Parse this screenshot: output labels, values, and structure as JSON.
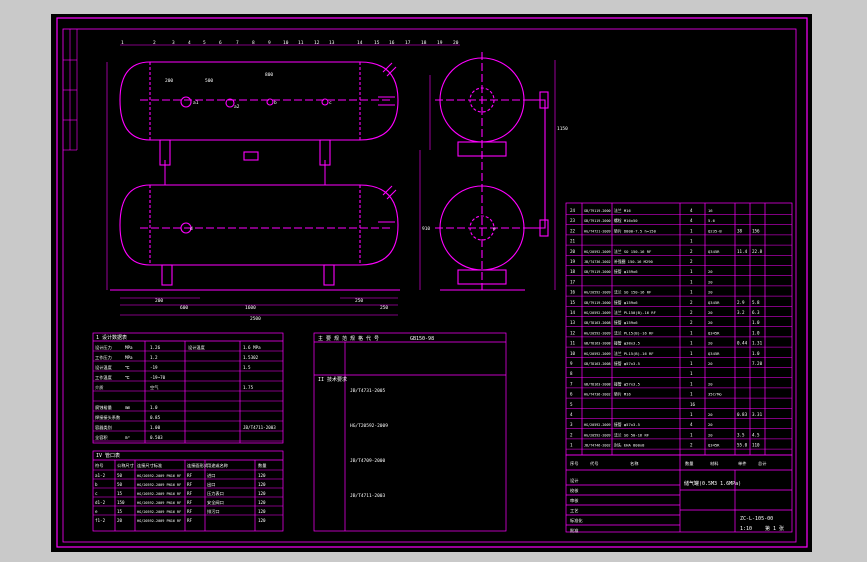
{
  "colors": {
    "background": "#c9c9c9",
    "sheet": "#000000",
    "drawing_line": "#ff00ff",
    "text": "#ffffff",
    "accent_yellow": "#ffff00",
    "accent_cyan": "#00ffff"
  },
  "drawing": {
    "balloon_numbers_top": [
      "1",
      "2",
      "3",
      "4",
      "5",
      "6",
      "7",
      "8",
      "9",
      "10",
      "11",
      "12",
      "13",
      "14",
      "15",
      "16",
      "17",
      "18",
      "19",
      "20"
    ],
    "dimensions": {
      "overall_length": "2500",
      "left_bottom_1": "200",
      "left_bottom_2": "600",
      "left_bottom_3": "1600",
      "right_bottom_1": "250",
      "right_bottom_2": "250",
      "side_dim_1": "200",
      "side_dim_2": "500",
      "side_dim_3": "800",
      "side_right_1": "1150",
      "side_right_2": "910"
    },
    "nozzle_labels": [
      "a1",
      "a2",
      "b",
      "c",
      "d",
      "e"
    ]
  },
  "parts_list": {
    "rows": [
      {
        "no": "24",
        "std": "GB/T9119-2000",
        "name": "法兰 M16",
        "qty": "4",
        "mat": "16",
        "w": "",
        "w2": ""
      },
      {
        "no": "23",
        "std": "GB/T9119-2000",
        "name": "螺栓 M16x50",
        "qty": "4",
        "mat": "5.6",
        "w": "",
        "w2": ""
      },
      {
        "no": "22",
        "std": "HG/T4721-2009",
        "name": "垫片 D800-7.5 h=150",
        "qty": "1",
        "mat": "Q235-B",
        "w": "38",
        "w2": "156"
      },
      {
        "no": "21",
        "std": "",
        "name": "",
        "qty": "1",
        "mat": "",
        "w": "",
        "w2": ""
      },
      {
        "no": "20",
        "std": "HG/20592-2009",
        "name": "法兰 SO 150-16 RF",
        "qty": "2",
        "mat": "Q345R",
        "w": "11.4",
        "w2": "22.8"
      },
      {
        "no": "19",
        "std": "JB/T4736-2002",
        "name": "补强圈 150-16 M290",
        "qty": "2",
        "mat": "",
        "w": "",
        "w2": ""
      },
      {
        "no": "18",
        "std": "GB/T9119-2000",
        "name": "接管 φ159x6",
        "qty": "1",
        "mat": "20",
        "w": "",
        "w2": ""
      },
      {
        "no": "17",
        "std": "",
        "name": "",
        "qty": "1",
        "mat": "20",
        "w": "",
        "w2": ""
      },
      {
        "no": "16",
        "std": "HG/20592-2009",
        "name": "法兰 SO 150-16 RF",
        "qty": "1",
        "mat": "20",
        "w": "",
        "w2": ""
      },
      {
        "no": "15",
        "std": "GB/T9119-2000",
        "name": "接管 φ159x6",
        "qty": "2",
        "mat": "Q345R",
        "w": "2.9",
        "w2": "5.8"
      },
      {
        "no": "14",
        "std": "HG/20592-2009",
        "name": "法兰 PL150(B)-16 RF",
        "qty": "2",
        "mat": "20",
        "w": "3.2",
        "w2": "6.3"
      },
      {
        "no": "13",
        "std": "GB/T8163-2008",
        "name": "接管 φ159x6",
        "qty": "2",
        "mat": "20",
        "w": "",
        "w2": "1.0"
      },
      {
        "no": "12",
        "std": "HG/20592-2009",
        "name": "法兰 PL15(B)-16 RF",
        "qty": "1",
        "mat": "Q345R",
        "w": "",
        "w2": "1.0"
      },
      {
        "no": "11",
        "std": "GB/T8163-2008",
        "name": "接管 φ38x3.5",
        "qty": "1",
        "mat": "20",
        "w": "0.44",
        "w2": "1.31"
      },
      {
        "no": "10",
        "std": "HG/20592-2009",
        "name": "法兰 PL15(B)-16 RF",
        "qty": "1",
        "mat": "Q345R",
        "w": "",
        "w2": "1.0"
      },
      {
        "no": "9",
        "std": "GB/T8163-2008",
        "name": "接管 φ57x3.5",
        "qty": "1",
        "mat": "20",
        "w": "",
        "w2": "7.20"
      },
      {
        "no": "8",
        "std": "",
        "name": "",
        "qty": "1",
        "mat": "",
        "w": "",
        "w2": ""
      },
      {
        "no": "7",
        "std": "GB/T8163-2008",
        "name": "接管 φ57x3.5",
        "qty": "1",
        "mat": "20",
        "w": "",
        "w2": ""
      },
      {
        "no": "6",
        "std": "HG/T4736-2002",
        "name": "垫片 M16",
        "qty": "1",
        "mat": "35CrMo",
        "w": "",
        "w2": ""
      },
      {
        "no": "5",
        "std": "",
        "name": "",
        "qty": "16",
        "mat": "",
        "w": "",
        "w2": ""
      },
      {
        "no": "4",
        "std": "",
        "name": "",
        "qty": "1",
        "mat": "20",
        "w": "0.83",
        "w2": "3.31"
      },
      {
        "no": "3",
        "std": "HG/20592-2009",
        "name": "接管 φ57x3.5",
        "qty": "4",
        "mat": "20",
        "w": "",
        "w2": ""
      },
      {
        "no": "2",
        "std": "HG/20592-2009",
        "name": "法兰 SO 50-16 RF",
        "qty": "1",
        "mat": "20",
        "w": "3.5",
        "w2": "4.5"
      },
      {
        "no": "1",
        "std": "JB/T4746-2002",
        "name": "封头 EHA 800x8",
        "qty": "2",
        "mat": "Q345R",
        "w": "55.0",
        "w2": "110"
      }
    ],
    "footer": {
      "b": "序号",
      "c": "代号",
      "d": "名称",
      "e": "数量",
      "f": "材料",
      "g": "单件",
      "h": "总计"
    }
  },
  "design_data_table": {
    "title": "1 设计数据表",
    "rows": [
      {
        "label": "设计压力",
        "val": "MPa",
        "a": "1.26",
        "b": "",
        "c": "设计温度",
        "d": "1.6 MPa"
      },
      {
        "label": "工作压力",
        "val": "MPa",
        "a": "1.2",
        "b": "",
        "c": "",
        "d": "1.5302"
      },
      {
        "label": "设计温度",
        "val": "℃",
        "a": "-19",
        "b": "",
        "c": "",
        "d": "1.5"
      },
      {
        "label": "工作温度",
        "val": "℃",
        "a": "-19~70",
        "b": "",
        "c": "",
        "d": ""
      },
      {
        "label": "介质",
        "val": "",
        "a": "空气",
        "b": "",
        "c": "",
        "d": "1.75"
      },
      {
        "label": "",
        "val": "",
        "a": "",
        "b": "",
        "c": "",
        "d": ""
      },
      {
        "label": "腐蚀裕量",
        "val": "mm",
        "a": "1.0",
        "b": "",
        "c": "",
        "d": ""
      },
      {
        "label": "焊接接头系数",
        "val": "",
        "a": "0.85",
        "b": "",
        "c": "",
        "d": ""
      },
      {
        "label": "容器类别",
        "val": "",
        "a": "1.00",
        "b": "",
        "c": "",
        "d": "JB/T4711-2003"
      },
      {
        "label": "全容积",
        "val": "m³",
        "a": "0.503",
        "b": "",
        "c": "",
        "d": ""
      }
    ]
  },
  "nozzle_table": {
    "title": "IV 管口表",
    "headers": [
      "符号",
      "公称尺寸",
      "连接尺寸标准",
      "连接面形式",
      "用途或名称",
      "",
      "数量"
    ],
    "rows": [
      {
        "sym": "a1-2",
        "dn": "50",
        "std": "HG/20592-2009 PN16 RF",
        "face": "RF",
        "use": "进口",
        "qty": "120"
      },
      {
        "sym": "b",
        "dn": "50",
        "std": "HG/20592-2009 PN16 RF",
        "face": "RF",
        "use": "出口",
        "qty": "120"
      },
      {
        "sym": "c",
        "dn": "15",
        "std": "HG/20592-2009 PN16 RF",
        "face": "RF",
        "use": "压力表口",
        "qty": "120"
      },
      {
        "sym": "d1-2",
        "dn": "150",
        "std": "HG/20592-2009 PN16 RF",
        "face": "RF",
        "use": "安全阀口",
        "qty": "120"
      },
      {
        "sym": "e",
        "dn": "15",
        "std": "HG/20592-2009 PN16 RF",
        "face": "RF",
        "use": "排污口",
        "qty": "120"
      },
      {
        "sym": "f1-2",
        "dn": "20",
        "std": "HG/20592-2009 PN16 RF",
        "face": "RF",
        "use": "",
        "qty": "120"
      }
    ]
  },
  "technical_requirements": {
    "title": "II 技术要求",
    "header_a": "主 要 规 范",
    "header_b": "规 格 代 号",
    "header_c": "GB150-98",
    "lines": [
      "JB/T4731-2005",
      "HG/T20592-2009",
      "JB/T4709-2000",
      "JB/T4711-2003"
    ]
  },
  "title_block": {
    "drawing_title": "储气罐(0.5M3 1.6MPa)",
    "drawing_no": "ZC-L-105-00",
    "scale": "1:10",
    "sheet": "第 1 张",
    "row_labels": [
      "设计",
      "校核",
      "审核",
      "工艺",
      "标准化",
      "批准"
    ]
  }
}
